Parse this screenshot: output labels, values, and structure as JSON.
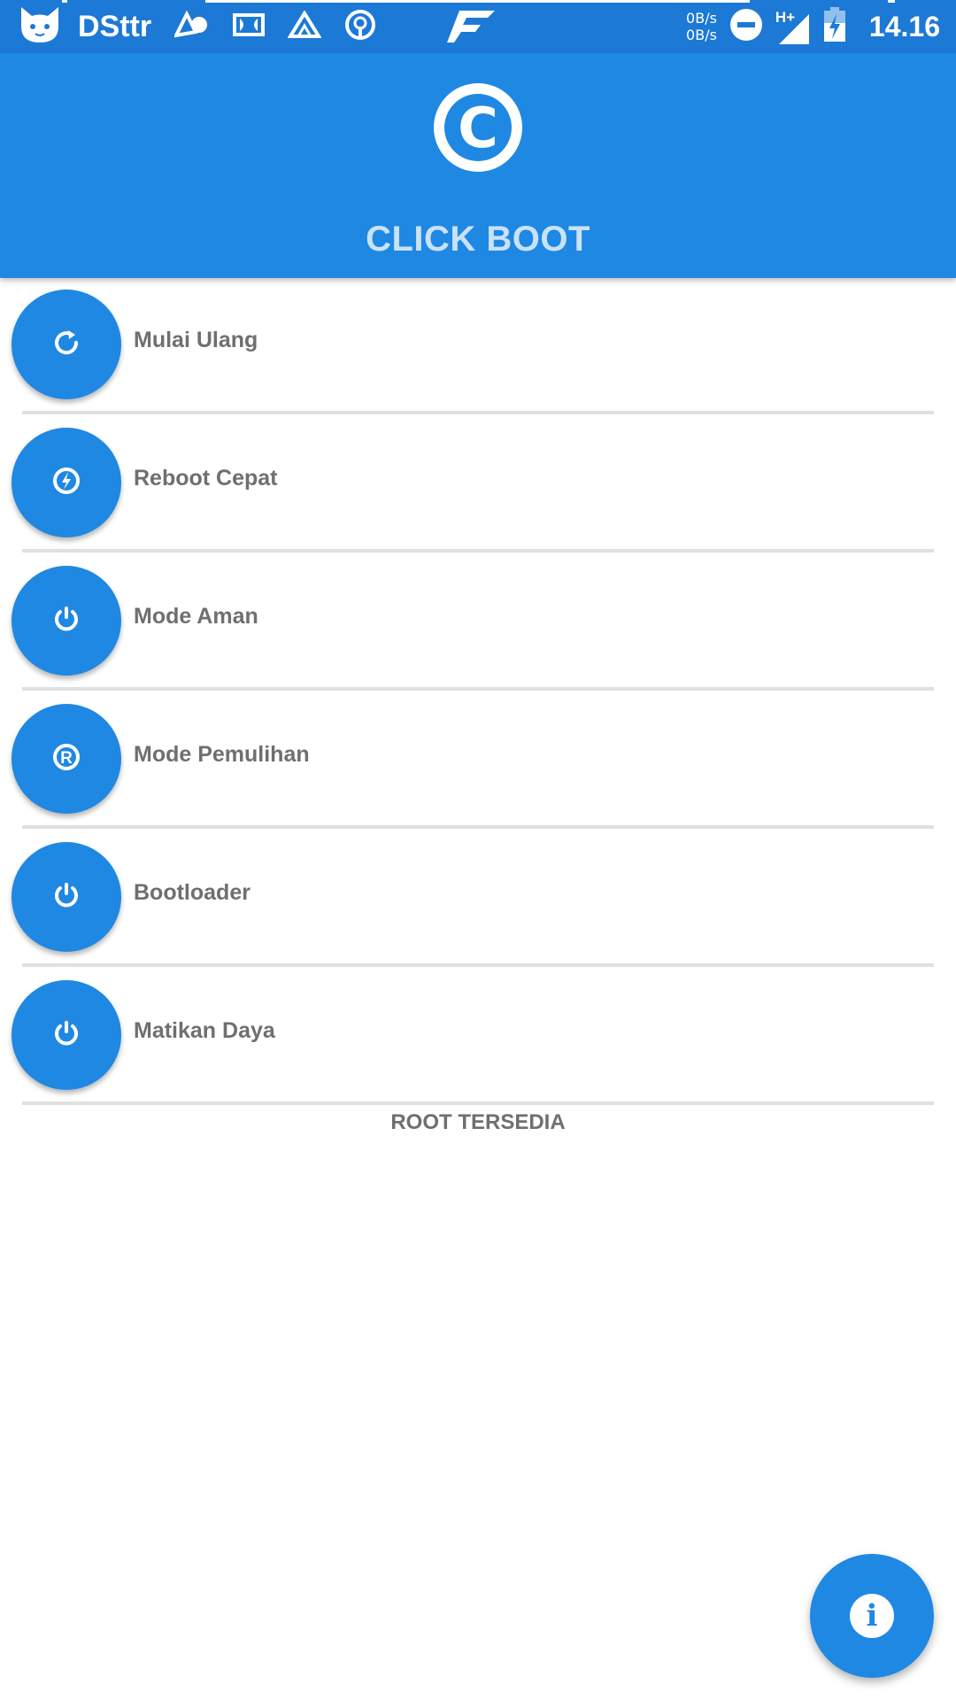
{
  "status_bar": {
    "carrier": "DSttr",
    "speed_up": "0B/s",
    "speed_down": "0B/s",
    "network": "H+",
    "time": "14.16"
  },
  "app": {
    "logo_letter": "C",
    "title": "CLICK BOOT"
  },
  "menu": {
    "items": [
      {
        "label": "Mulai Ulang",
        "icon": "restart-icon"
      },
      {
        "label": "Reboot Cepat",
        "icon": "fast-reboot-icon"
      },
      {
        "label": "Mode Aman",
        "icon": "power-icon"
      },
      {
        "label": "Mode Pemulihan",
        "icon": "recovery-icon"
      },
      {
        "label": "Bootloader",
        "icon": "power-icon"
      },
      {
        "label": "Matikan Daya",
        "icon": "power-icon"
      }
    ]
  },
  "footer": {
    "root_status": "ROOT TERSEDIA"
  },
  "fab": {
    "icon_letter": "i"
  },
  "colors": {
    "primary": "#1f88e3",
    "status_bar": "#1c79d6",
    "title_text": "#c9e2f8",
    "label_text": "#6f6f6f",
    "divider": "#e0e0e0"
  }
}
